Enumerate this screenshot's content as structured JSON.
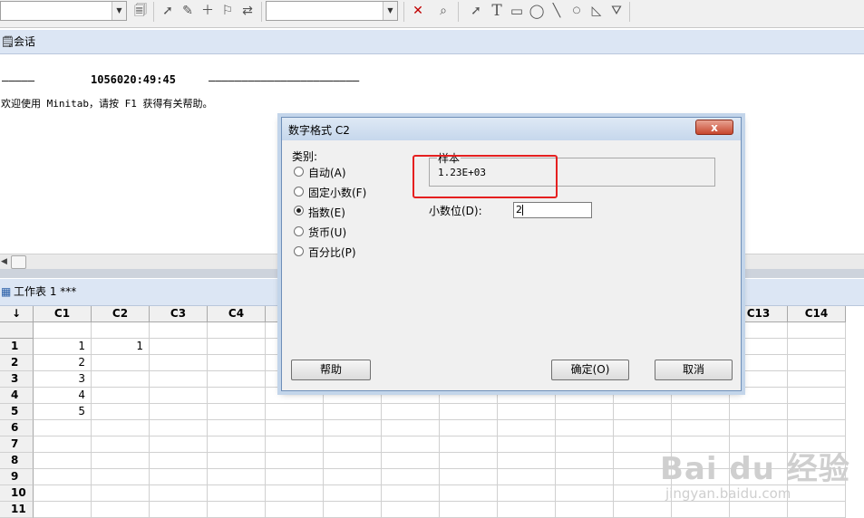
{
  "session": {
    "title": "会话",
    "line1_dashes_left": "—————",
    "line1_time": "1056020:49:45",
    "line1_dashes_right": "———————————————————————",
    "welcome": "欢迎使用 Minitab，请按 F1 获得有关帮助。"
  },
  "worksheet": {
    "title": "工作表 1 ***",
    "corner": "↓",
    "columns": [
      "C1",
      "C2",
      "C3",
      "C4",
      "",
      "",
      "",
      "",
      "",
      "",
      "",
      "",
      "C13",
      "C14"
    ],
    "rows": [
      "1",
      "2",
      "3",
      "4",
      "5",
      "6",
      "7",
      "8",
      "9",
      "10",
      "11"
    ],
    "c1_values": [
      "1",
      "2",
      "3",
      "4",
      "5"
    ],
    "c2_values": [
      "1"
    ]
  },
  "dialog": {
    "title": "数字格式 C2",
    "close": "x",
    "category_label": "类别:",
    "options": [
      "自动(A)",
      "固定小数(F)",
      "指数(E)",
      "货币(U)",
      "百分比(P)"
    ],
    "selected": "指数(E)",
    "sample_label": "样本",
    "sample_value": "1.23E+03",
    "decimals_label": "小数位(D):",
    "decimals_value": "2",
    "buttons": {
      "help": "帮助",
      "ok": "确定(O)",
      "cancel": "取消"
    }
  },
  "watermark": {
    "brand": "Bai du 经验",
    "url": "jingyan.baidu.com"
  },
  "colors": {
    "highlight": "#e52020",
    "title_bar": "#dce6f4"
  }
}
